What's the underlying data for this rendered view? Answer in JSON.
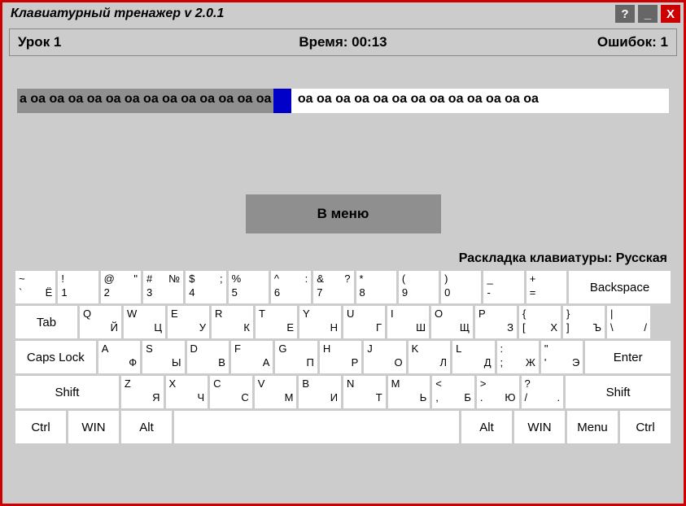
{
  "title": "Клавиатурный тренажер v 2.0.1",
  "winbtns": {
    "help": "?",
    "min": "_",
    "close": "X"
  },
  "status": {
    "lesson": "Урок 1",
    "time_label": "Время:  00:13",
    "errors": "Ошибок: 1"
  },
  "typing": {
    "done": "а оа оа оа оа оа оа оа оа оа оа оа оа оа",
    "rest": " оа оа оа оа оа оа оа оа оа оа оа оа оа"
  },
  "menu_btn": "В меню",
  "kb_label": "Раскладка клавиатуры: Русская",
  "r1": [
    {
      "tl": "~",
      "tr": "",
      "bl": "`",
      "br": "Ё"
    },
    {
      "tl": "!",
      "tr": "",
      "bl": "1",
      "br": ""
    },
    {
      "tl": "@",
      "tr": "\"",
      "bl": "2",
      "br": ""
    },
    {
      "tl": "#",
      "tr": "№",
      "bl": "3",
      "br": ""
    },
    {
      "tl": "$",
      "tr": ";",
      "bl": "4",
      "br": ""
    },
    {
      "tl": "%",
      "tr": "",
      "bl": "5",
      "br": ""
    },
    {
      "tl": "^",
      "tr": ":",
      "bl": "6",
      "br": ""
    },
    {
      "tl": "&",
      "tr": "?",
      "bl": "7",
      "br": ""
    },
    {
      "tl": "*",
      "tr": "",
      "bl": "8",
      "br": ""
    },
    {
      "tl": "(",
      "tr": "",
      "bl": "9",
      "br": ""
    },
    {
      "tl": ")",
      "tr": "",
      "bl": "0",
      "br": ""
    },
    {
      "tl": "_",
      "tr": "",
      "bl": "-",
      "br": ""
    },
    {
      "tl": "+",
      "tr": "",
      "bl": "=",
      "br": ""
    }
  ],
  "r1_bksp": "Backspace",
  "r2_tab": "Tab",
  "r2": [
    {
      "top": "Q",
      "bl": "",
      "br": "Й"
    },
    {
      "top": "W",
      "bl": "",
      "br": "Ц"
    },
    {
      "top": "E",
      "bl": "",
      "br": "У"
    },
    {
      "top": "R",
      "bl": "",
      "br": "К"
    },
    {
      "top": "T",
      "bl": "",
      "br": "Е"
    },
    {
      "top": "Y",
      "bl": "",
      "br": "Н"
    },
    {
      "top": "U",
      "bl": "",
      "br": "Г"
    },
    {
      "top": "I",
      "bl": "",
      "br": "Ш"
    },
    {
      "top": "O",
      "bl": "",
      "br": "Щ"
    },
    {
      "top": "P",
      "bl": "",
      "br": "З"
    },
    {
      "top": "{",
      "bl": "[",
      "br": "Х"
    },
    {
      "top": "}",
      "bl": "]",
      "br": "Ъ"
    },
    {
      "top": "|",
      "bl": "\\",
      "br": "/"
    }
  ],
  "r3_caps": "Caps Lock",
  "r3": [
    {
      "top": "A",
      "bl": "",
      "br": "Ф"
    },
    {
      "top": "S",
      "bl": "",
      "br": "Ы"
    },
    {
      "top": "D",
      "bl": "",
      "br": "В"
    },
    {
      "top": "F",
      "bl": "",
      "br": "А"
    },
    {
      "top": "G",
      "bl": "",
      "br": "П"
    },
    {
      "top": "H",
      "bl": "",
      "br": "Р"
    },
    {
      "top": "J",
      "bl": "",
      "br": "О"
    },
    {
      "top": "K",
      "bl": "",
      "br": "Л"
    },
    {
      "top": "L",
      "bl": "",
      "br": "Д"
    },
    {
      "top": ":",
      "bl": ";",
      "br": "Ж"
    },
    {
      "top": "\"",
      "bl": "'",
      "br": "Э"
    }
  ],
  "r3_enter": "Enter",
  "r4_shift": "Shift",
  "r4": [
    {
      "top": "Z",
      "bl": "",
      "br": "Я"
    },
    {
      "top": "X",
      "bl": "",
      "br": "Ч"
    },
    {
      "top": "C",
      "bl": "",
      "br": "С"
    },
    {
      "top": "V",
      "bl": "",
      "br": "М"
    },
    {
      "top": "B",
      "bl": "",
      "br": "И"
    },
    {
      "top": "N",
      "bl": "",
      "br": "Т"
    },
    {
      "top": "M",
      "bl": "",
      "br": "Ь"
    },
    {
      "top": "<",
      "bl": ",",
      "br": "Б"
    },
    {
      "top": ">",
      "bl": ".",
      "br": "Ю"
    },
    {
      "top": "?",
      "bl": "/",
      "br": "."
    }
  ],
  "r5": {
    "ctrl": "Ctrl",
    "win": "WIN",
    "alt": "Alt",
    "menu": "Menu"
  }
}
